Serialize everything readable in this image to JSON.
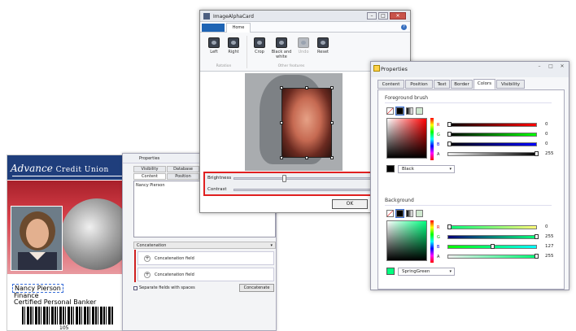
{
  "id_card": {
    "brand_word1": "Advance",
    "brand_word2": "Credit Union",
    "name": "Nancy Pierson",
    "department": "Finance",
    "title": "Certified Personal Banker",
    "barcode_number": "105"
  },
  "properties_small": {
    "title": "Properties",
    "tabs_row1": [
      "Visibility",
      "Database"
    ],
    "tabs_row2": [
      "Content",
      "Position"
    ],
    "textbox_value": "Nancy Pierson",
    "concat_header": "Concatenation",
    "fields": [
      "Concatenation field",
      "Concatenation field"
    ],
    "checkbox_label": "Separate fields with spaces",
    "concat_button": "Concatenate"
  },
  "image_alpha_card": {
    "title": "ImageAlphaCard",
    "window_buttons": [
      "–",
      "□",
      "✕"
    ],
    "file_tab": "",
    "home_tab": "Home",
    "help": "?",
    "ribbon": {
      "rotation_buttons": [
        "Left",
        "Right"
      ],
      "rotation_group": "Rotation",
      "feature_buttons": [
        "Crop",
        "Black and white",
        "Undo",
        "Reset"
      ],
      "features_group": "Other features"
    },
    "brightness_label": "Brightness",
    "contrast_label": "Contrast",
    "brightness_level": 0.3,
    "contrast_level": 0.88,
    "ok_button": "OK"
  },
  "properties_large": {
    "title": "Properties",
    "window_buttons": [
      "–",
      "□",
      "✕"
    ],
    "tabs": [
      "Content",
      "Position",
      "Text",
      "Border",
      "Colors",
      "Visibility"
    ],
    "active_tab": "Colors",
    "foreground": {
      "label": "Foreground brush",
      "channels": [
        "R",
        "G",
        "B",
        "A"
      ],
      "values": [
        "0",
        "0",
        "0",
        "255"
      ],
      "color_name": "Black",
      "color_hex": "#000000"
    },
    "background": {
      "label": "Background",
      "channels": [
        "R",
        "G",
        "B",
        "A"
      ],
      "values": [
        "0",
        "255",
        "127",
        "255"
      ],
      "color_name": "SpringGreen",
      "color_hex": "#00ff7f"
    }
  }
}
